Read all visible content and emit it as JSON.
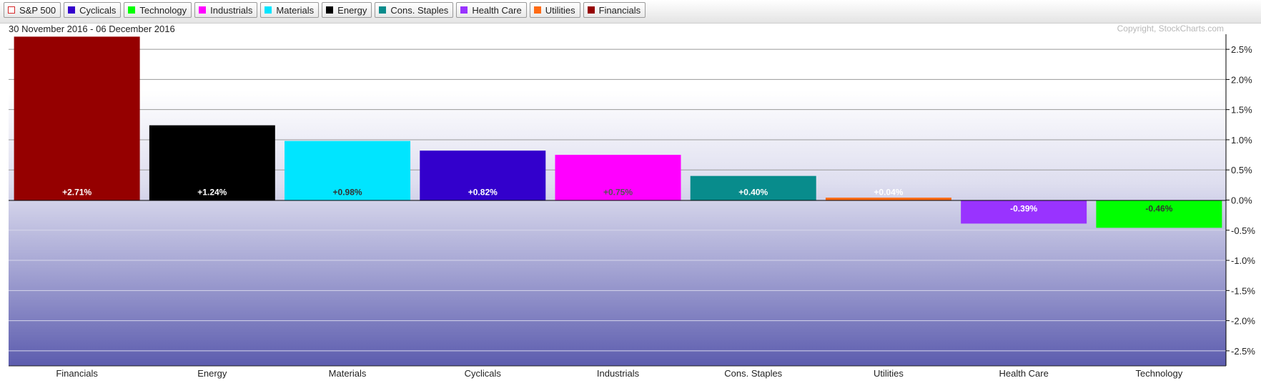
{
  "legend": [
    {
      "label": "S&P 500",
      "color": "#d62728",
      "outline": true
    },
    {
      "label": "Cyclicals",
      "color": "#3300cc"
    },
    {
      "label": "Technology",
      "color": "#00ff00"
    },
    {
      "label": "Industrials",
      "color": "#ff00ff"
    },
    {
      "label": "Materials",
      "color": "#00e5ff"
    },
    {
      "label": "Energy",
      "color": "#000000"
    },
    {
      "label": "Cons. Staples",
      "color": "#088c8c"
    },
    {
      "label": "Health Care",
      "color": "#9933ff"
    },
    {
      "label": "Utilities",
      "color": "#ff6a13"
    },
    {
      "label": "Financials",
      "color": "#950000"
    }
  ],
  "date_range": "30 November 2016 - 06 December 2016",
  "copyright": "Copyright, StockCharts.com",
  "chart_data": {
    "type": "bar",
    "categories": [
      "Financials",
      "Energy",
      "Materials",
      "Cyclicals",
      "Industrials",
      "Cons. Staples",
      "Utilities",
      "Health Care",
      "Technology"
    ],
    "values": [
      2.71,
      1.24,
      0.98,
      0.82,
      0.75,
      0.4,
      0.04,
      -0.39,
      -0.46
    ],
    "value_labels": [
      "+2.71%",
      "+1.24%",
      "+0.98%",
      "+0.82%",
      "+0.75%",
      "+0.40%",
      "+0.04%",
      "-0.39%",
      "-0.46%"
    ],
    "colors": [
      "#950000",
      "#000000",
      "#00e5ff",
      "#3300cc",
      "#ff00ff",
      "#088c8c",
      "#ff6a13",
      "#9933ff",
      "#00ff00"
    ],
    "label_colors": [
      "#ffffff",
      "#ffffff",
      "#333333",
      "#ffffff",
      "#555555",
      "#ffffff",
      "#ffffff",
      "#ffffff",
      "#333333"
    ],
    "ylim": [
      -2.75,
      2.75
    ],
    "yticks": [
      2.5,
      2.0,
      1.5,
      1.0,
      0.5,
      0.0,
      -0.5,
      -1.0,
      -1.5,
      -2.0,
      -2.5
    ],
    "ytick_labels": [
      "2.5%",
      "2.0%",
      "1.5%",
      "1.0%",
      "0.5%",
      "0.0%",
      "-0.5%",
      "-1.0%",
      "-1.5%",
      "-2.0%",
      "-2.5%"
    ],
    "y_axis_side": "right",
    "grid": true,
    "xlabel": "",
    "ylabel": ""
  }
}
